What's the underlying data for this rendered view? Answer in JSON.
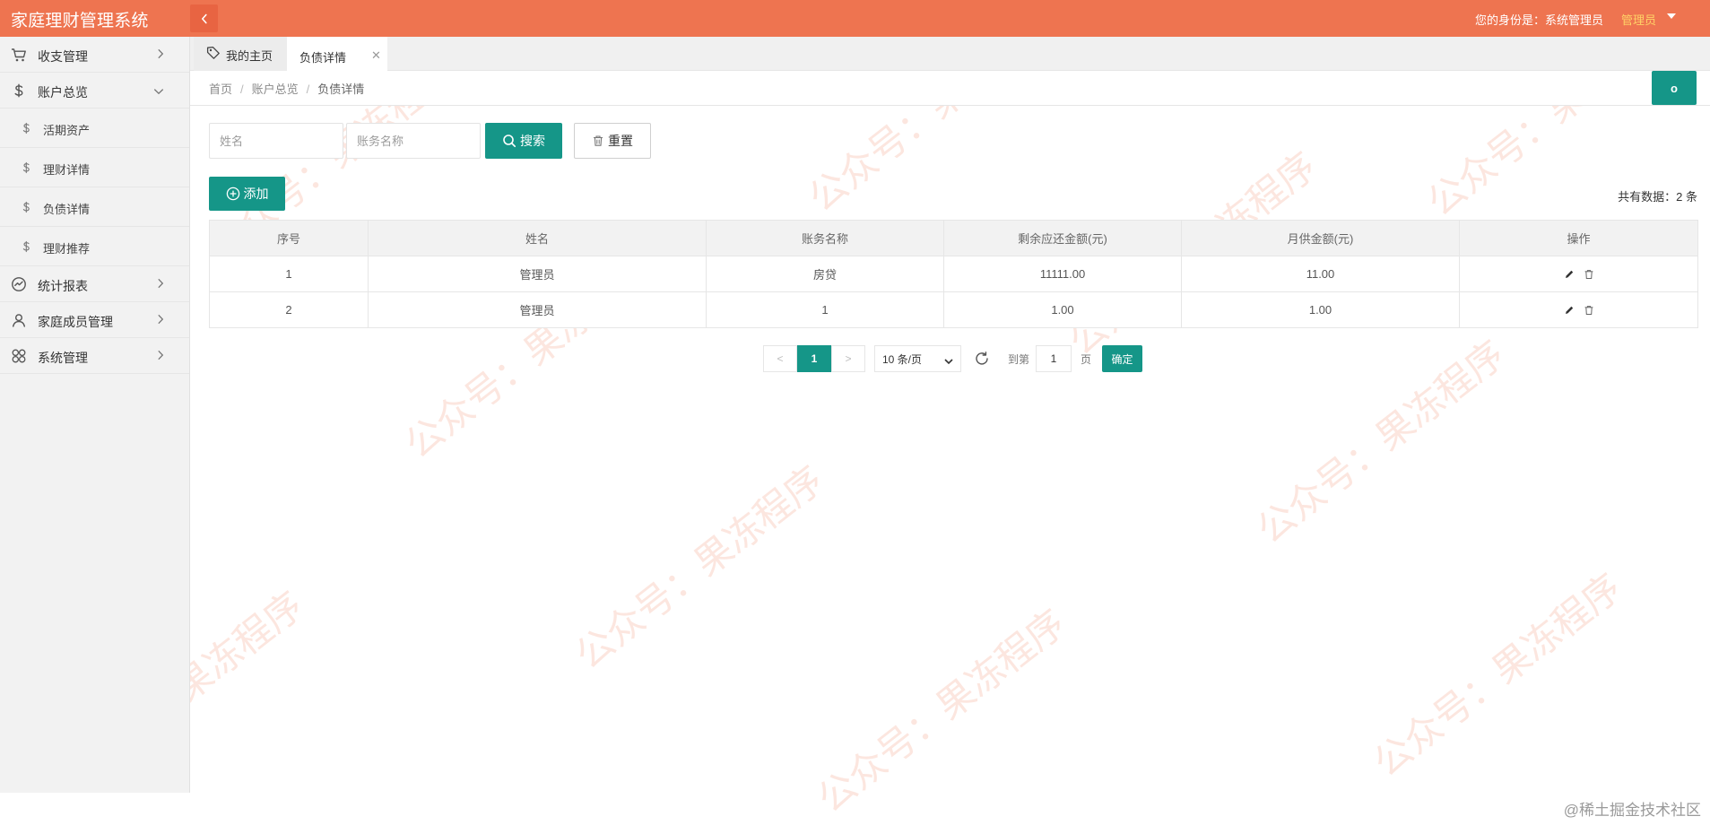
{
  "header": {
    "title": "家庭理财管理系统",
    "identity_label": "您的身份是：系统管理员",
    "role": "管理员"
  },
  "sidebar": {
    "items": [
      {
        "label": "收支管理",
        "icon": "cart-icon",
        "expanded": false
      },
      {
        "label": "账户总览",
        "icon": "dollar-icon",
        "expanded": true,
        "children": [
          {
            "label": "活期资产",
            "icon": "dollar-icon"
          },
          {
            "label": "理财详情",
            "icon": "dollar-icon"
          },
          {
            "label": "负债详情",
            "icon": "dollar-icon"
          },
          {
            "label": "理财推荐",
            "icon": "dollar-icon"
          }
        ]
      },
      {
        "label": "统计报表",
        "icon": "chart-circle-icon",
        "expanded": false
      },
      {
        "label": "家庭成员管理",
        "icon": "user-icon",
        "expanded": false
      },
      {
        "label": "系统管理",
        "icon": "apps-icon",
        "expanded": false
      }
    ]
  },
  "tabs": [
    {
      "label": "我的主页",
      "icon": "tag-icon",
      "active": false
    },
    {
      "label": "负债详情",
      "active": true,
      "closable": true
    }
  ],
  "breadcrumb": [
    "首页",
    "账户总览",
    "负债详情"
  ],
  "refresh_tile_label": "o",
  "search": {
    "name_placeholder": "姓名",
    "account_placeholder": "账务名称",
    "search_label": "搜索",
    "reset_label": "重置"
  },
  "actions": {
    "add_label": "添加",
    "count_text": "共有数据：2 条"
  },
  "table": {
    "columns": [
      "序号",
      "姓名",
      "账务名称",
      "剩余应还金额(元)",
      "月供金额(元)",
      "操作"
    ],
    "rows": [
      [
        "1",
        "管理员",
        "房贷",
        "11111.00",
        "11.00"
      ],
      [
        "2",
        "管理员",
        "1",
        "1.00",
        "1.00"
      ]
    ]
  },
  "pagination": {
    "prev": "<",
    "current": "1",
    "next": ">",
    "page_size": "10 条/页",
    "goto_label": "到第",
    "goto_value": "1",
    "page_unit": "页",
    "confirm_label": "确定"
  },
  "watermark_text": "公众号：果冻程序",
  "footer_mark": "@稀土掘金技术社区",
  "colors": {
    "topbar": "#ee7450",
    "accent": "#159688",
    "role": "#ffd266"
  }
}
